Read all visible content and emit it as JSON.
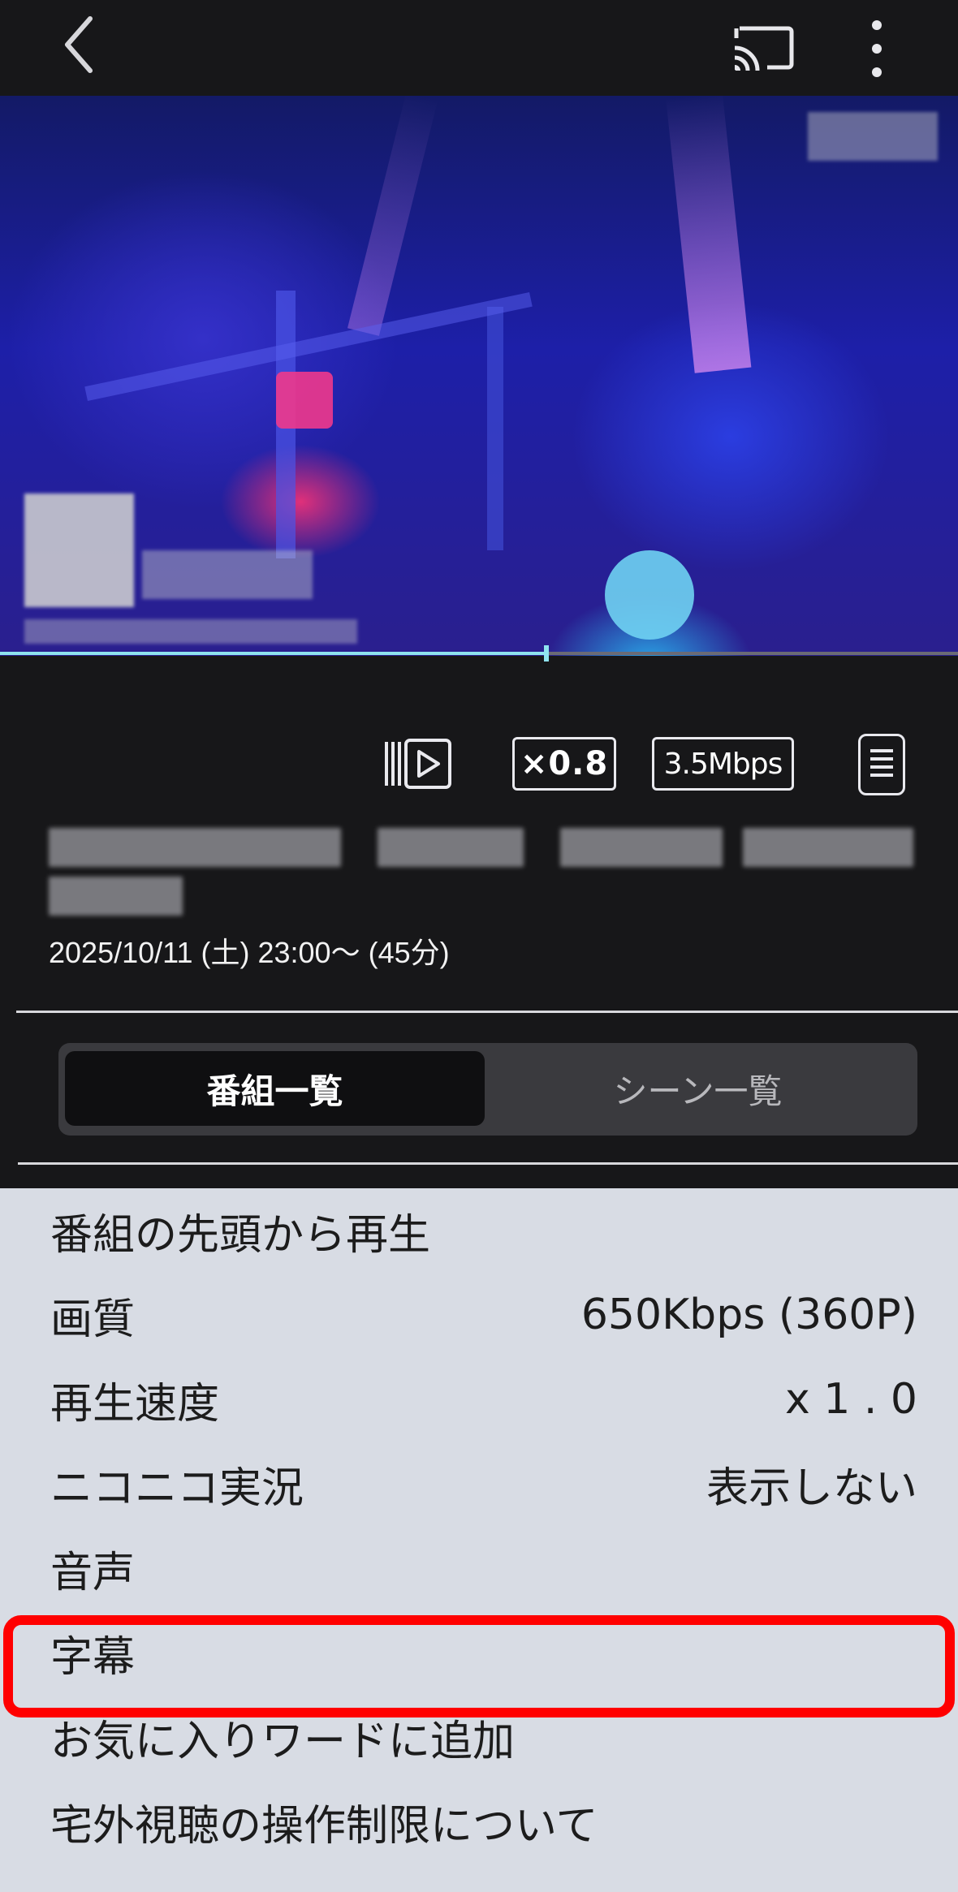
{
  "topbar": {
    "back_icon": "chevron-left-icon",
    "cast_icon": "cast-icon",
    "more_icon": "more-vertical-icon"
  },
  "player": {
    "progress": 0.57,
    "controls": {
      "playlist_icon": "play-queue-icon",
      "speed_label": "×0.8",
      "bitrate_label": "3.5Mbps",
      "list_icon": "list-icon"
    }
  },
  "program": {
    "air_date": "2025/10/11 (土) 23:00〜 (45分)"
  },
  "tabs": {
    "program_list": "番組一覧",
    "scene_list": "シーン一覧"
  },
  "menu": {
    "items": [
      {
        "label": "番組の先頭から再生",
        "value": ""
      },
      {
        "label": "画質",
        "value": "650Kbps (360P)"
      },
      {
        "label": "再生速度",
        "value": "x 1 . 0"
      },
      {
        "label": "ニコニコ実況",
        "value": "表示しない"
      },
      {
        "label": "音声",
        "value": ""
      },
      {
        "label": "字幕",
        "value": ""
      },
      {
        "label": "お気に入りワードに追加",
        "value": ""
      },
      {
        "label": "宅外視聴の操作制限について",
        "value": ""
      }
    ],
    "highlighted_index": 5,
    "highlight_color": "#ff0000"
  }
}
